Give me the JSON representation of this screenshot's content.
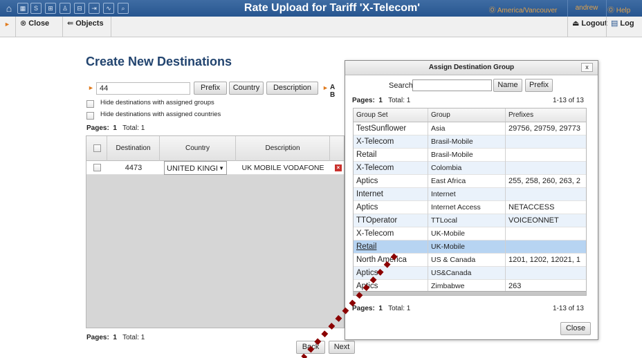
{
  "topbar": {
    "title": "Rate Upload for Tariff 'X-Telecom'",
    "timezone": "Ⓞ America/Vancouver",
    "user": "andrew",
    "help": "Ⓞ Help",
    "icons": [
      "home-icon",
      "grid-icon",
      "s-icon",
      "apps-icon",
      "person-icon",
      "calc-icon",
      "export-icon",
      "chart-icon",
      "search-icon"
    ]
  },
  "toolbar": {
    "close_label": "Close",
    "objects_label": "Objects",
    "logout_label": "Logout",
    "log_label": "Log"
  },
  "main": {
    "title": "Create New Destinations",
    "filter_value": "44",
    "prefix_button": "Prefix",
    "country_button": "Country",
    "description_button": "Description",
    "ab_label": "A B",
    "hide_groups_label": "Hide destinations with assigned groups",
    "hide_countries_label": "Hide destinations with assigned countries",
    "pages_label": "Pages:",
    "pages_value": "1",
    "total_label": "Total: 1",
    "columns": [
      "Destination",
      "Country",
      "Description"
    ],
    "row": {
      "destination": "4473",
      "country": "UNITED KINGI",
      "description": "UK MOBILE VODAFONE"
    },
    "bottom_pages_label": "Pages:",
    "bottom_pages_value": "1",
    "bottom_total_label": "Total: 1",
    "back_button": "Back",
    "next_button": "Next"
  },
  "dialog": {
    "title": "Assign Destination Group",
    "close_x": "x",
    "search_label": "Search",
    "search_value": "",
    "name_button": "Name",
    "prefix_button": "Prefix",
    "pages_label": "Pages:",
    "pages_value": "1",
    "total_label": "Total: 1",
    "range": "1-13 of 13",
    "columns": [
      "Group Set",
      "Group",
      "Prefixes"
    ],
    "rows": [
      {
        "group_set": "TestSunflower",
        "group": "Asia",
        "prefixes": "29756, 29759, 29773"
      },
      {
        "group_set": "X-Telecom",
        "group": "Brasil-Mobile",
        "prefixes": ""
      },
      {
        "group_set": "Retail",
        "group": "Brasil-Mobile",
        "prefixes": ""
      },
      {
        "group_set": "X-Telecom",
        "group": "Colombia",
        "prefixes": ""
      },
      {
        "group_set": "Aptics",
        "group": "East Africa",
        "prefixes": "255, 258, 260, 263, 2"
      },
      {
        "group_set": "Internet",
        "group": "Internet",
        "prefixes": ""
      },
      {
        "group_set": "Aptics",
        "group": "Internet Access",
        "prefixes": "NETACCESS"
      },
      {
        "group_set": "TTOperator",
        "group": "TTLocal",
        "prefixes": "VOICEONNET"
      },
      {
        "group_set": "X-Telecom",
        "group": "UK-Mobile",
        "prefixes": ""
      },
      {
        "group_set": "Retail",
        "group": "UK-Mobile",
        "prefixes": ""
      },
      {
        "group_set": "North America",
        "group": "US & Canada",
        "prefixes": "1201, 1202, 12021, 1"
      },
      {
        "group_set": "Aptics",
        "group": "US&Canada",
        "prefixes": ""
      },
      {
        "group_set": "Aptics",
        "group": "Zimbabwe",
        "prefixes": "263"
      }
    ],
    "selected_row": 9,
    "footer_pages_label": "Pages:",
    "footer_pages_value": "1",
    "footer_total_label": "Total: 1",
    "footer_range": "1-13 of 13",
    "close_button": "Close"
  },
  "colors": {
    "topbar": "#27558f",
    "title_blue": "#22446f",
    "accent_orange": "#e07b1e",
    "row_alt": "#eaf2fb",
    "row_selected": "#b7d4f2",
    "overlay_red": "#8b0000"
  }
}
